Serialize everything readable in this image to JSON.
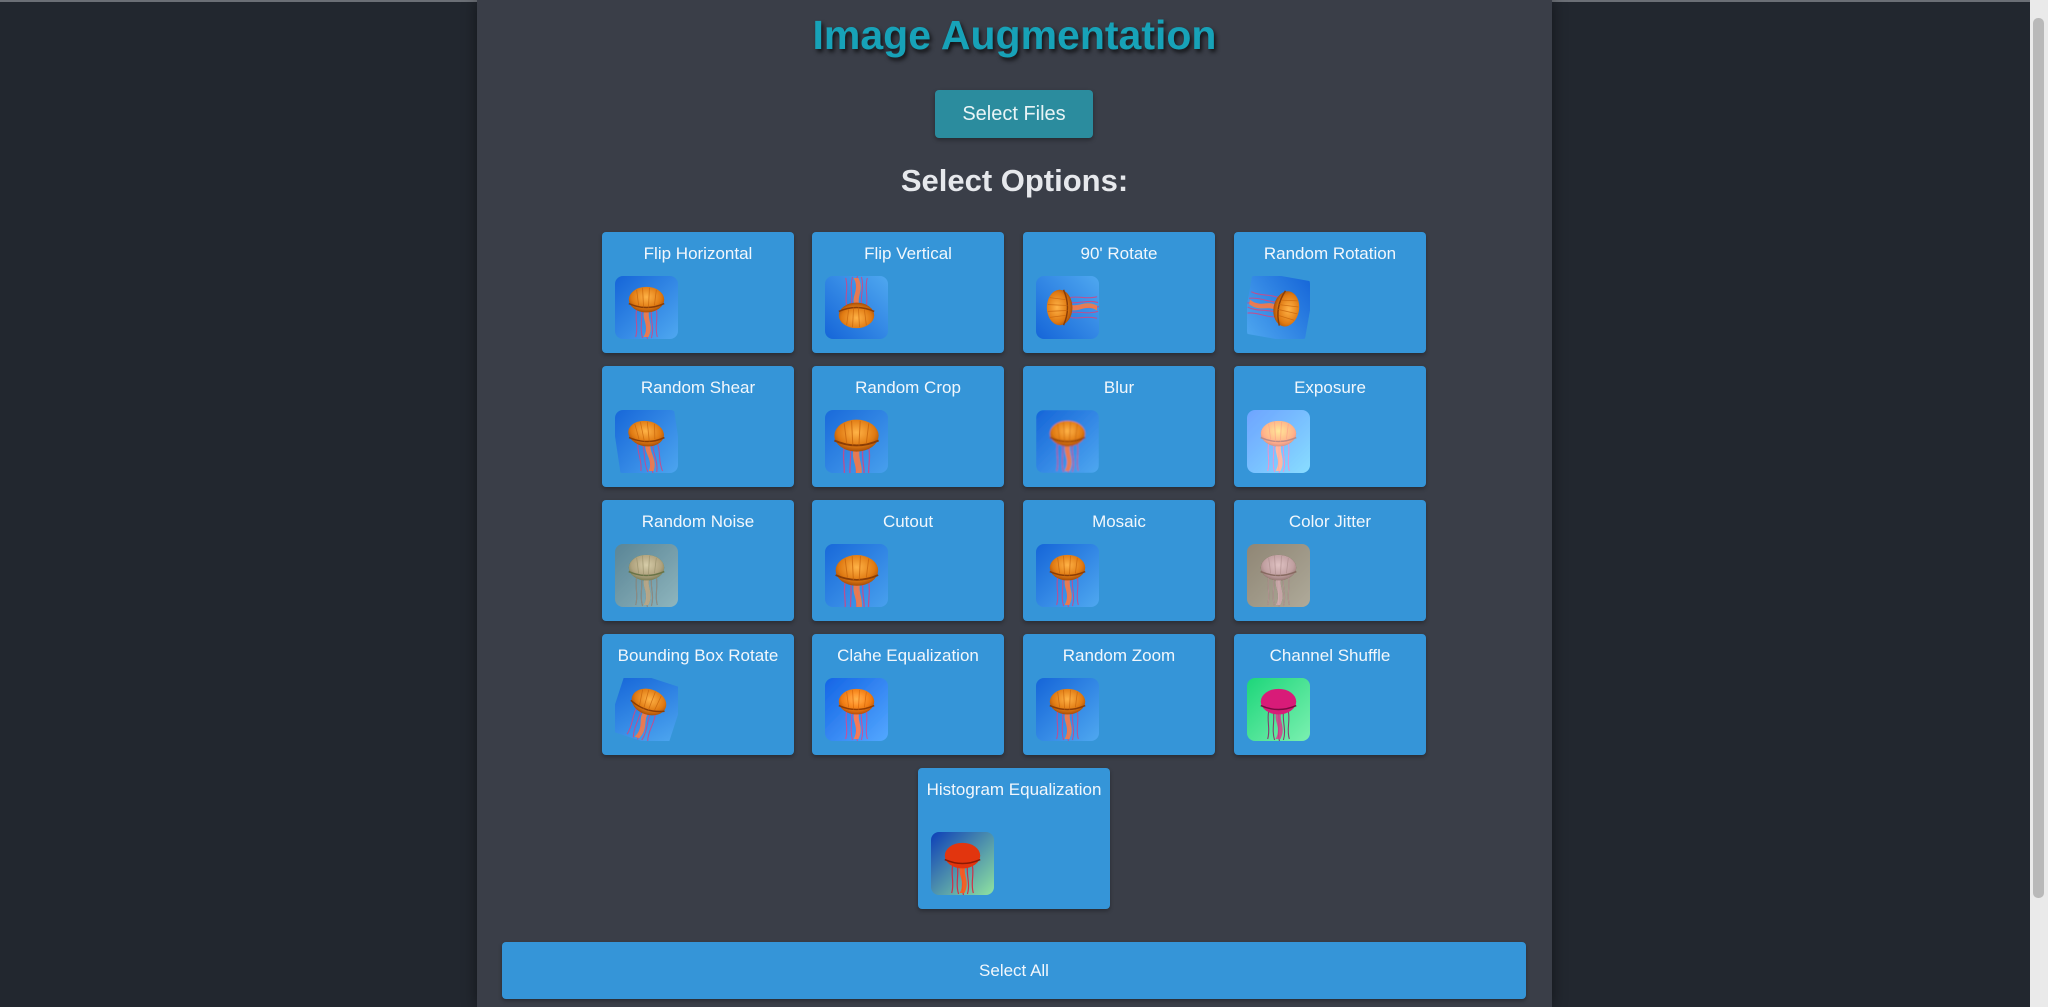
{
  "page": {
    "title": "Image Augmentation",
    "select_files_label": "Select Files",
    "options_title": "Select Options:",
    "select_all_label": "Select All"
  },
  "colors": {
    "background": "#22272f",
    "panel": "#3a3e48",
    "title": "#17a2b8",
    "card": "#3595d8",
    "button": "#2b8c9e"
  },
  "options": [
    {
      "label": "Flip Horizontal",
      "preview": "jellyfish-flip-horizontal"
    },
    {
      "label": "Flip Vertical",
      "preview": "jellyfish-flip-vertical"
    },
    {
      "label": "90' Rotate",
      "preview": "jellyfish-rotate-90"
    },
    {
      "label": "Random Rotation",
      "preview": "jellyfish-random-rotation"
    },
    {
      "label": "Random Shear",
      "preview": "jellyfish-random-shear"
    },
    {
      "label": "Random Crop",
      "preview": "jellyfish-random-crop"
    },
    {
      "label": "Blur",
      "preview": "jellyfish-blur"
    },
    {
      "label": "Exposure",
      "preview": "jellyfish-exposure"
    },
    {
      "label": "Random Noise",
      "preview": "jellyfish-random-noise"
    },
    {
      "label": "Cutout",
      "preview": "jellyfish-cutout"
    },
    {
      "label": "Mosaic",
      "preview": "jellyfish-mosaic"
    },
    {
      "label": "Color Jitter",
      "preview": "jellyfish-color-jitter"
    },
    {
      "label": "Bounding Box Rotate",
      "preview": "jellyfish-bbox-rotate"
    },
    {
      "label": "Clahe Equalization",
      "preview": "jellyfish-clahe"
    },
    {
      "label": "Random Zoom",
      "preview": "jellyfish-random-zoom"
    },
    {
      "label": "Channel Shuffle",
      "preview": "jellyfish-channel-shuffle"
    },
    {
      "label": "Histogram Equalization",
      "preview": "jellyfish-histogram-equalization"
    }
  ]
}
